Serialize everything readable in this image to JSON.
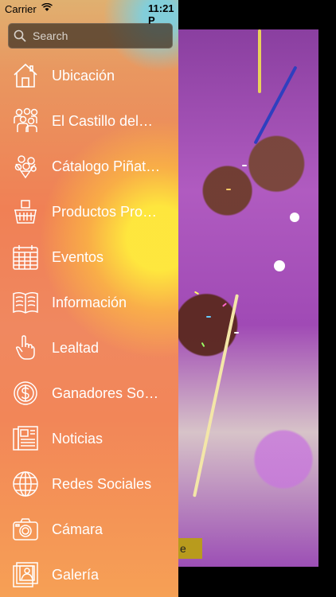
{
  "status_bar": {
    "carrier": "Carrier",
    "time": "11:21 P"
  },
  "search": {
    "placeholder": "Search"
  },
  "menu": [
    {
      "label": "Ubicación",
      "icon": "house-icon"
    },
    {
      "label": "El Castillo del…",
      "icon": "people-icon"
    },
    {
      "label": "Cátalogo Piñat…",
      "icon": "flowers-icon"
    },
    {
      "label": "Productos Pro…",
      "icon": "basket-icon"
    },
    {
      "label": "Eventos",
      "icon": "calendar-icon"
    },
    {
      "label": "Información",
      "icon": "book-icon"
    },
    {
      "label": "Lealtad",
      "icon": "hand-pointer-icon"
    },
    {
      "label": "Ganadores So…",
      "icon": "dollar-coin-icon"
    },
    {
      "label": "Noticias",
      "icon": "newspaper-icon"
    },
    {
      "label": "Redes Sociales",
      "icon": "globe-icon"
    },
    {
      "label": "Cámara",
      "icon": "camera-icon"
    },
    {
      "label": "Galería",
      "icon": "gallery-icon"
    }
  ],
  "background": {
    "button_text": "e"
  },
  "colors": {
    "menu_text": "#ffffff",
    "search_bg": "#46372a"
  }
}
